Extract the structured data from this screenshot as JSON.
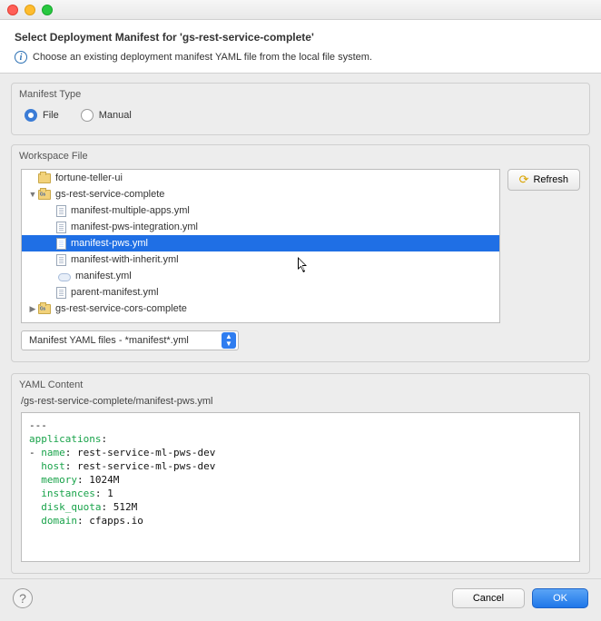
{
  "header": {
    "title": "Select Deployment Manifest for 'gs-rest-service-complete'",
    "subtitle": "Choose an existing deployment manifest YAML file from the local file system."
  },
  "manifestType": {
    "label": "Manifest Type",
    "options": {
      "file": "File",
      "manual": "Manual"
    },
    "selected": "file"
  },
  "workspace": {
    "label": "Workspace File",
    "refresh": "Refresh",
    "filter": "Manifest YAML files - *manifest*.yml",
    "tree": {
      "top": "fortune-teller-ui",
      "project": "gs-rest-service-complete",
      "files": [
        "manifest-multiple-apps.yml",
        "manifest-pws-integration.yml",
        "manifest-pws.yml",
        "manifest-with-inherit.yml",
        "manifest.yml",
        "parent-manifest.yml"
      ],
      "project2": "gs-rest-service-cors-complete",
      "selected": "manifest-pws.yml"
    }
  },
  "yaml": {
    "label": "YAML Content",
    "path": "/gs-rest-service-complete/manifest-pws.yml",
    "content": {
      "applications_kw": "applications",
      "name_kw": "name",
      "name_val": "rest-service-ml-pws-dev",
      "host_kw": "host",
      "host_val": "rest-service-ml-pws-dev",
      "memory_kw": "memory",
      "memory_val": "1024M",
      "instances_kw": "instances",
      "instances_val": "1",
      "disk_kw": "disk_quota",
      "disk_val": "512M",
      "domain_kw": "domain",
      "domain_val": "cfapps.io"
    }
  },
  "footer": {
    "cancel": "Cancel",
    "ok": "OK",
    "help": "?"
  }
}
